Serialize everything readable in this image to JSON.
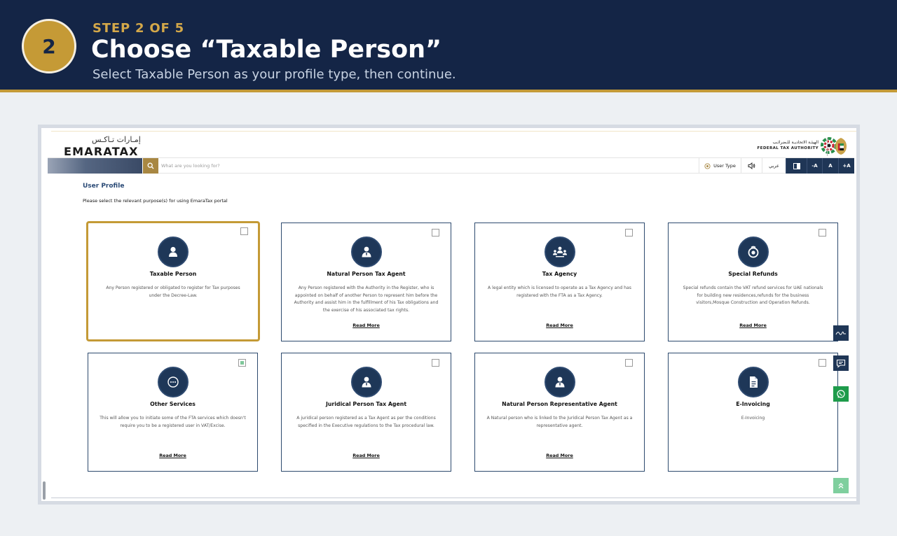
{
  "step": {
    "number": "2",
    "kicker": "STEP 2 OF 5",
    "title": "Choose “Taxable Person”",
    "subtitle": "Select Taxable Person as your profile type, then continue."
  },
  "portal": {
    "logo_ar": "إمـارات تـاكـس",
    "logo_en": "EMARATAX",
    "authority_ar": "الهيئـة الاتحاديـة للـضرائـب",
    "authority_en": "FEDERAL TAX AUTHORITY",
    "search_placeholder": "What are you looking for?",
    "user_type_label": "User Type",
    "language_label": "عربي",
    "font_decrease": "-A",
    "font_normal": "A",
    "font_increase": "+A"
  },
  "profile": {
    "title": "User Profile",
    "subtitle": "Please select the relevant purpose(s) for using EmaraTax portal",
    "cards": [
      {
        "title": "Taxable Person",
        "desc": "Any Person registered or obligated to register for Tax purposes under the Decree-Law.",
        "link": "",
        "icon": "person-icon"
      },
      {
        "title": "Natural Person Tax Agent",
        "desc": "Any Person registered with the Authority in the Register, who is appointed on behalf of another Person to represent him before the Authority and assist him in the fulfillment of his Tax obligations and the exercise of his associated tax rights.",
        "link": "Read More",
        "icon": "agent-icon"
      },
      {
        "title": "Tax Agency",
        "desc": "A legal entity which is licensed to operate as a Tax Agency and has registered with the FTA as a Tax Agency.",
        "link": "Read More",
        "icon": "agency-icon"
      },
      {
        "title": "Special Refunds",
        "desc": "Special refunds contain the VAT refund services for UAE nationals for building new residences,refunds for the business visitors,Mosque Construction and Operation Refunds.",
        "link": "Read More",
        "icon": "refund-icon"
      },
      {
        "title": "Other Services",
        "desc": "This will allow you to initiate some of the FTA services which doesn't require you to be a registered user in VAT/Excise.",
        "link": "Read More",
        "icon": "more-icon"
      },
      {
        "title": "Juridical Person Tax Agent",
        "desc": "A juridical person registered as a Tax Agent as per the conditions specified in the Executive regulations to the Tax procedural law.",
        "link": "Read More",
        "icon": "agent-icon"
      },
      {
        "title": "Natural Person Representative Agent",
        "desc": "A Natural person who is linked to the Juridical Person Tax Agent as a representative agent.",
        "link": "Read More",
        "icon": "agent-icon"
      },
      {
        "title": "E-Invoicing",
        "desc": "E-Invoicing",
        "link": "",
        "icon": "document-icon"
      }
    ]
  },
  "colors": {
    "navy": "#142546",
    "gold": "#c49a36",
    "card_border": "#2d4a6e",
    "whatsapp": "#1e9b4b"
  }
}
